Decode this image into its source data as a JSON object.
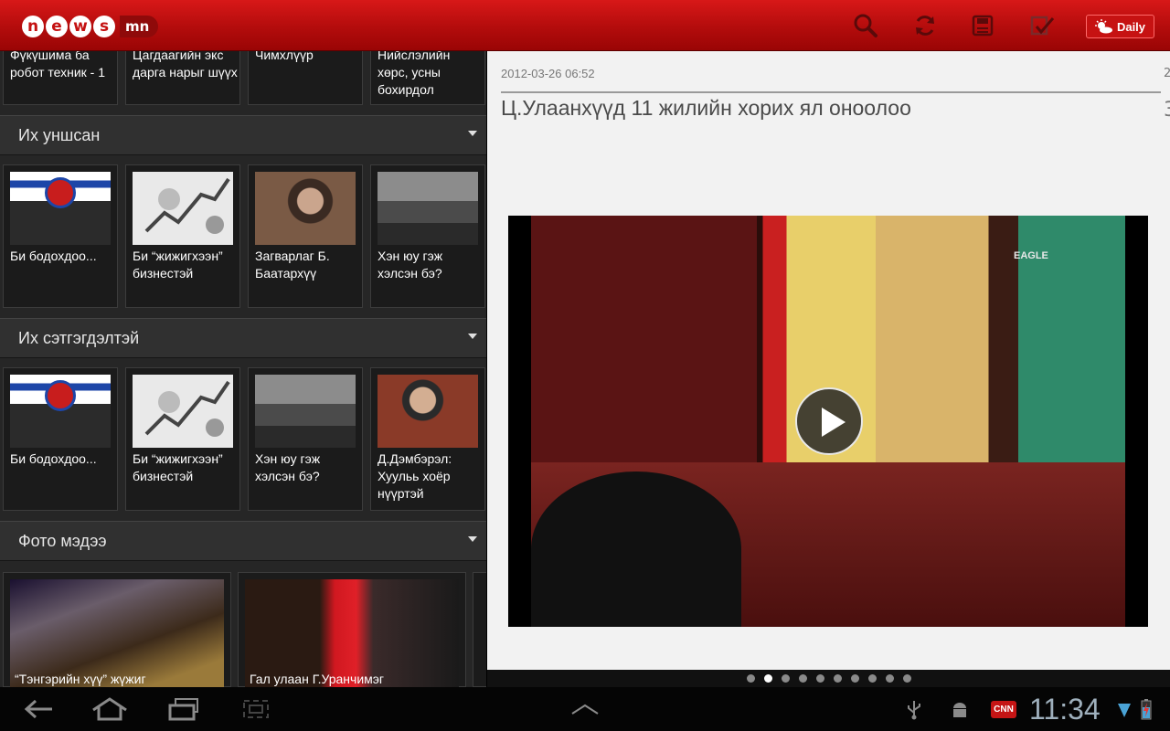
{
  "app": {
    "logo_letters": [
      "n",
      "e",
      "w",
      "s"
    ],
    "logo_tld": "mn",
    "daily_label": "Daily"
  },
  "toolbar": {
    "icons": [
      "search-icon",
      "refresh-icon",
      "save-icon",
      "edit-icon"
    ]
  },
  "top_tiles": [
    {
      "caption": "Фүкүшима ба робот техник - 1"
    },
    {
      "caption": "Цагдаагийн экс дарга нарыг шүүх"
    },
    {
      "caption": "Чимхлүүр"
    },
    {
      "caption": "Нийслэлийн хөрс, усны бохирдол"
    }
  ],
  "sections": [
    {
      "title": "Их уншсан",
      "tiles": [
        {
          "caption": "Би бодохдоо..."
        },
        {
          "caption": "Би “жижигхээн” бизнестэй"
        },
        {
          "caption": "Загварлаг Б. Баатархүү"
        },
        {
          "caption": "Хэн юу гэж хэлсэн бэ?"
        }
      ]
    },
    {
      "title": "Их сэтгэгдэлтэй",
      "tiles": [
        {
          "caption": "Би бодохдоо..."
        },
        {
          "caption": "Би “жижигхээн” бизнестэй"
        },
        {
          "caption": "Хэн юу гэж хэлсэн бэ?"
        },
        {
          "caption": "Д.Дэмбэрэл: Хуульь хоёр нүүртэй"
        }
      ]
    },
    {
      "title": "Фото мэдээ",
      "tiles": [
        {
          "caption": "“Тэнгэрийн хүү” жүжиг"
        },
        {
          "caption": "Гал улаан Г.Уранчимэг"
        }
      ]
    }
  ],
  "article": {
    "date": "2012-03-26 06:52",
    "headline": "Ц.Улаанхүүд 11 жилийн хорих ял оноолоо",
    "video_watermark": "EAGLE",
    "next_date_peek": "2",
    "next_headline_peek": "3"
  },
  "pager": {
    "count": 10,
    "active_index": 1
  },
  "system_bar": {
    "clock": "11:34",
    "notification_badge": "CNN"
  },
  "colors": {
    "brand_red": "#c41010",
    "toolbar_icon": "#5a0a0a"
  }
}
